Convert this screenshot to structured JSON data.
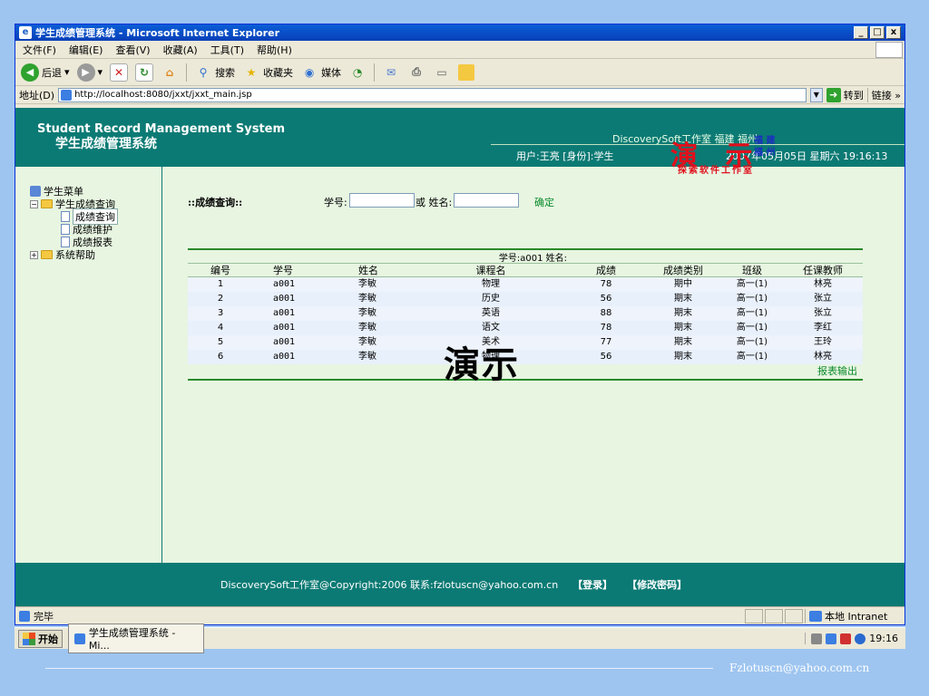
{
  "window": {
    "title": "学生成绩管理系统 - Microsoft Internet Explorer",
    "controls": [
      "_",
      "□",
      "x"
    ]
  },
  "menu": [
    "文件(F)",
    "编辑(E)",
    "查看(V)",
    "收藏(A)",
    "工具(T)",
    "帮助(H)"
  ],
  "toolbar": {
    "back": "后退",
    "search": "搜索",
    "favorites": "收藏夹",
    "media": "媒体"
  },
  "address": {
    "label": "地址(D)",
    "url": "http://localhost:8080/jxxt/jxxt_main.jsp",
    "go": "转到",
    "links": "链接"
  },
  "banner": {
    "title_en": "Student Record Management System",
    "title_cn": "学生成绩管理系统",
    "studio": "DiscoverySoft工作室 福建 福州",
    "user": "用户:王亮 [身份]:学生",
    "datetime": "2007年05月05日 星期六 19:16:13"
  },
  "sidebar": {
    "root": "学生菜单",
    "group": "学生成绩查询",
    "items": [
      "成绩查询",
      "成绩维护",
      "成绩报表"
    ],
    "help": "系统帮助"
  },
  "query": {
    "title": "::成绩查询::",
    "student_id_label": "学号:",
    "student_id_value": "",
    "or_name_label": "或 姓名:",
    "name_value": "",
    "confirm": "确定"
  },
  "watermark": {
    "demo": "演 示",
    "place_line1": "福 建",
    "place_line2": "福 州",
    "studio": "探索软件工作室",
    "center": "演示"
  },
  "grid": {
    "info": "学号:a001 姓名:",
    "headers": [
      "编号",
      "学号",
      "姓名",
      "课程名",
      "成绩",
      "成绩类别",
      "班级",
      "任课教师"
    ],
    "rows": [
      [
        "1",
        "a001",
        "李敏",
        "物理",
        "78",
        "期中",
        "高一(1)",
        "林亮"
      ],
      [
        "2",
        "a001",
        "李敏",
        "历史",
        "56",
        "期末",
        "高一(1)",
        "张立"
      ],
      [
        "3",
        "a001",
        "李敏",
        "英语",
        "88",
        "期末",
        "高一(1)",
        "张立"
      ],
      [
        "4",
        "a001",
        "李敏",
        "语文",
        "78",
        "期末",
        "高一(1)",
        "李红"
      ],
      [
        "5",
        "a001",
        "李敏",
        "美术",
        "77",
        "期末",
        "高一(1)",
        "王玲"
      ],
      [
        "6",
        "a001",
        "李敏",
        "物理",
        "56",
        "期末",
        "高一(1)",
        "林亮"
      ]
    ],
    "export": "报表输出"
  },
  "footer": {
    "copyright": "DiscoverySoft工作室@Copyright:2006 联系:fzlotuscn@yahoo.com.cn",
    "login": "【登录】",
    "change_password": "【修改密码】"
  },
  "status": {
    "text": "完毕",
    "zone": "本地 Intranet"
  },
  "taskbar": {
    "start": "开始",
    "task": "学生成绩管理系统 - Mi...",
    "clock": "19:16"
  },
  "slide": {
    "email": "Fzlotuscn@yahoo.com.cn"
  }
}
